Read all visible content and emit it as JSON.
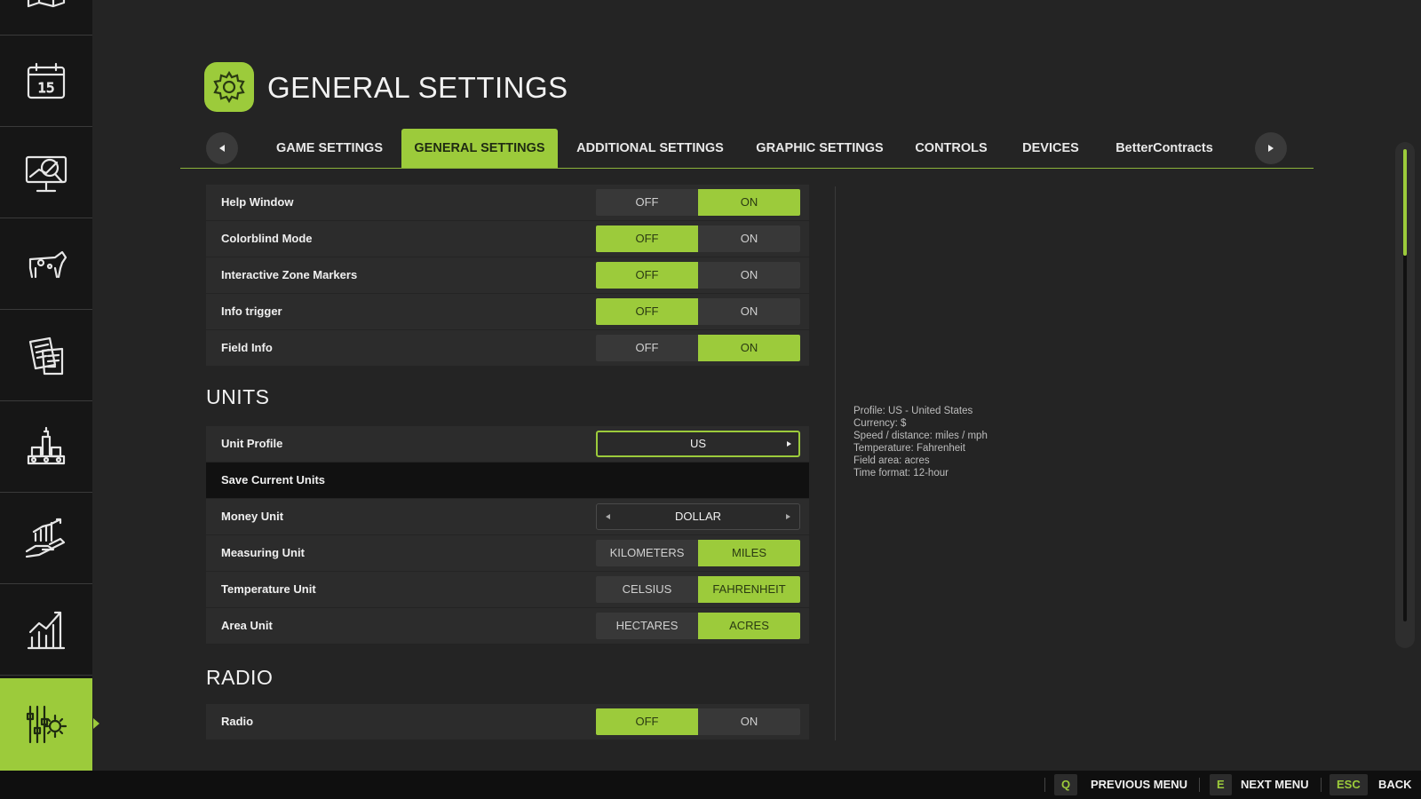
{
  "colors": {
    "accent": "#9ccb3b",
    "background": "#242424",
    "sidebar": "#161616"
  },
  "sidebar": {
    "items": [
      {
        "icon": "map-icon"
      },
      {
        "icon": "calendar-icon",
        "text": "15"
      },
      {
        "icon": "monitor-chart-icon"
      },
      {
        "icon": "cow-icon"
      },
      {
        "icon": "contracts-icon"
      },
      {
        "icon": "production-icon"
      },
      {
        "icon": "finance-icon"
      },
      {
        "icon": "statistics-icon"
      },
      {
        "icon": "settings-icon",
        "active": true
      }
    ]
  },
  "header": {
    "title": "GENERAL SETTINGS",
    "icon": "gear-icon"
  },
  "tabs": [
    {
      "label": "GAME SETTINGS"
    },
    {
      "label": "GENERAL SETTINGS",
      "active": true
    },
    {
      "label": "ADDITIONAL SETTINGS"
    },
    {
      "label": "GRAPHIC SETTINGS"
    },
    {
      "label": "CONTROLS"
    },
    {
      "label": "DEVICES"
    },
    {
      "label": "BetterContracts"
    }
  ],
  "general": {
    "help_window": {
      "label": "Help Window",
      "off": "OFF",
      "on": "ON",
      "selected": "ON"
    },
    "colorblind": {
      "label": "Colorblind Mode",
      "off": "OFF",
      "on": "ON",
      "selected": "OFF"
    },
    "zone_markers": {
      "label": "Interactive Zone Markers",
      "off": "OFF",
      "on": "ON",
      "selected": "OFF"
    },
    "info_trigger": {
      "label": "Info trigger",
      "off": "OFF",
      "on": "ON",
      "selected": "OFF"
    },
    "field_info": {
      "label": "Field Info",
      "off": "OFF",
      "on": "ON",
      "selected": "ON"
    }
  },
  "units": {
    "heading": "UNITS",
    "profile": {
      "label": "Unit Profile",
      "value": "US"
    },
    "save": {
      "label": "Save Current Units"
    },
    "money": {
      "label": "Money Unit",
      "value": "DOLLAR"
    },
    "measuring": {
      "label": "Measuring Unit",
      "a": "KILOMETERS",
      "b": "MILES",
      "selected": "MILES"
    },
    "temperature": {
      "label": "Temperature Unit",
      "a": "CELSIUS",
      "b": "FAHRENHEIT",
      "selected": "FAHRENHEIT"
    },
    "area": {
      "label": "Area Unit",
      "a": "HECTARES",
      "b": "ACRES",
      "selected": "ACRES"
    }
  },
  "radio": {
    "heading": "RADIO",
    "radio": {
      "label": "Radio",
      "off": "OFF",
      "on": "ON",
      "selected": "OFF"
    }
  },
  "info": {
    "lines": [
      "Profile: US - United States",
      "Currency: $",
      "Speed / distance: miles / mph",
      "Temperature: Fahrenheit",
      "Field area: acres",
      "Time format: 12-hour"
    ]
  },
  "scroll": {
    "position_fraction": 0.0
  },
  "footer": {
    "prev": {
      "key": "Q",
      "label": "PREVIOUS MENU"
    },
    "next": {
      "key": "E",
      "label": "NEXT MENU"
    },
    "back": {
      "key": "ESC",
      "label": "BACK"
    }
  }
}
